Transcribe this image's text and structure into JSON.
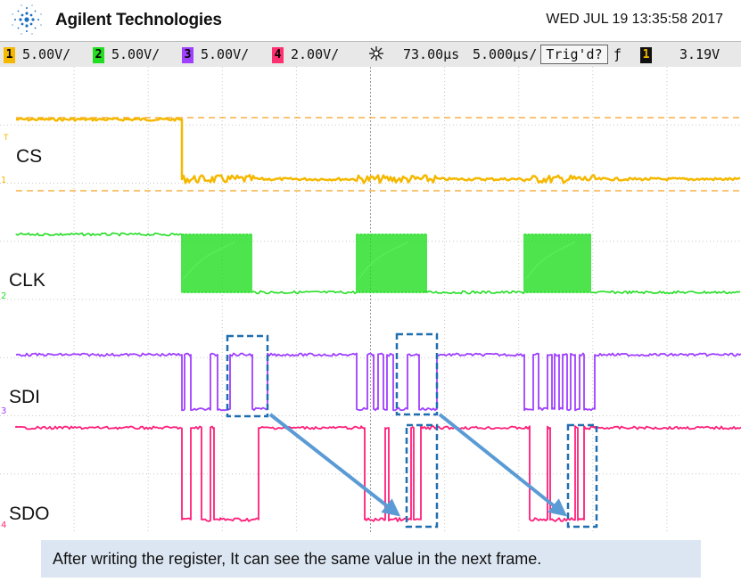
{
  "header": {
    "brand": "Agilent Technologies",
    "datetime": "WED JUL 19 13:35:58 2017"
  },
  "status": {
    "channels": [
      {
        "num": "1",
        "scale": "5.00V/",
        "color": "#f5b800"
      },
      {
        "num": "2",
        "scale": "5.00V/",
        "color": "#22dd22"
      },
      {
        "num": "3",
        "scale": "5.00V/",
        "color": "#a040ff"
      },
      {
        "num": "4",
        "scale": "2.00V/",
        "color": "#ff3070"
      }
    ],
    "time_offset": "73.00μs",
    "timebase": "5.000μs/",
    "trigger_state": "Trig'd?",
    "trigger_edge": "ƒ",
    "trigger_source": "1",
    "trigger_level": "3.19V"
  },
  "traces": [
    {
      "label": "CS",
      "marker": "1",
      "color": "#f5b800"
    },
    {
      "label": "CLK",
      "marker": "2",
      "color": "#22dd22"
    },
    {
      "label": "SDI",
      "marker": "3",
      "color": "#a040ff"
    },
    {
      "label": "SDO",
      "marker": "4",
      "color": "#ff3070"
    }
  ],
  "trigger_marker": "T",
  "annotation": "After writing the register, It can see the same value in the next frame."
}
